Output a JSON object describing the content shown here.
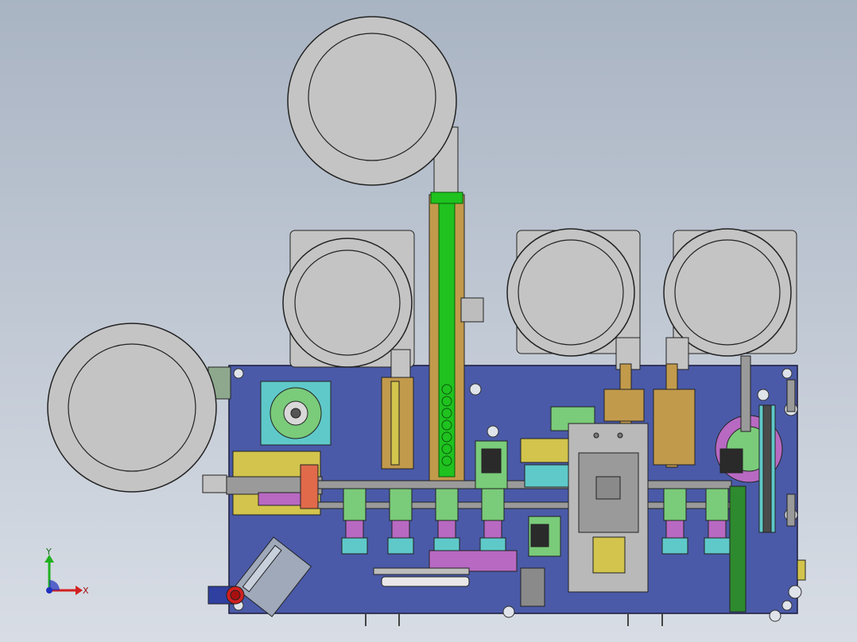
{
  "triad": {
    "x_label": "X",
    "y_label": "Y"
  },
  "colors": {
    "bg_top": "#a9b4c3",
    "bg_bottom": "#d8dde5",
    "base_plate": "#4a5aa8",
    "bowl_fill": "#c4c4c4",
    "bowl_stroke": "#222222",
    "feeder_track": "#1fc21f",
    "rail_wood": "#c29a4c",
    "mech_green": "#7acb7a",
    "mech_purple": "#b869c2",
    "mech_cyan": "#5fc9c9",
    "mech_yellow": "#d2c44c",
    "slide_gray": "#9a9a9a",
    "axis_x": "#d22020",
    "axis_y": "#20b020",
    "axis_z": "#2030c0"
  }
}
